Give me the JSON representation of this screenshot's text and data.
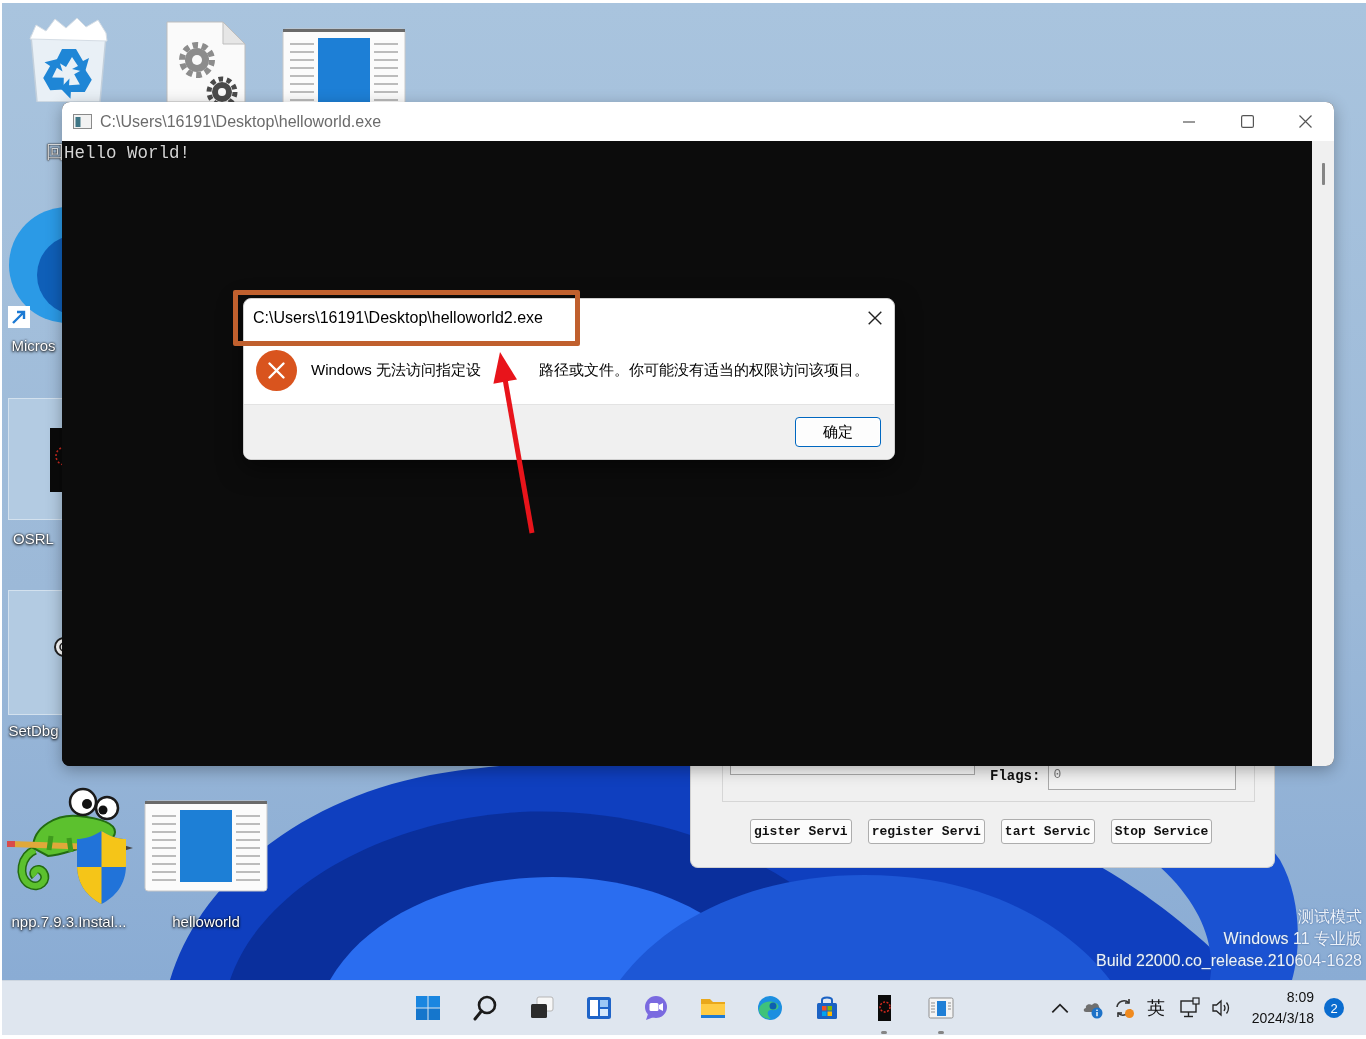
{
  "desktop_icons": [
    {
      "kind": "browser",
      "label": "Micros"
    },
    {
      "kind": "thumbnail",
      "label": "OSRL"
    },
    {
      "kind": "roundapp",
      "label": "SetDbg"
    },
    {
      "kind": "installer",
      "label": "npp.7.9.3.Instal..."
    },
    {
      "kind": "window",
      "label": "helloworld"
    }
  ],
  "console_window": {
    "title": "C:\\Users\\16191\\Desktop\\helloworld.exe",
    "output": [
      "回Hello World!"
    ]
  },
  "service_dialog": {
    "flags_label": "Flags:",
    "flags_value": "0",
    "buttons": [
      "gister Servi",
      "register Servi",
      "tart Servic",
      "Stop Service"
    ]
  },
  "error_dialog": {
    "title": "C:\\Users\\16191\\Desktop\\helloworld2.exe",
    "message_parts": [
      "Windows 无法访问指定设",
      "路径或文件。你可能没有适当的权限访问该项目。"
    ],
    "ok_button": "确定"
  },
  "taskbar": {
    "apps": [
      {
        "kind": "start",
        "running": false
      },
      {
        "kind": "search",
        "running": false
      },
      {
        "kind": "taskview",
        "running": false
      },
      {
        "kind": "widgets",
        "running": false
      },
      {
        "kind": "chat",
        "running": false
      },
      {
        "kind": "files",
        "running": false
      },
      {
        "kind": "browser",
        "running": false
      },
      {
        "kind": "store",
        "running": false
      },
      {
        "kind": "ring",
        "running": true
      },
      {
        "kind": "window",
        "running": true
      }
    ],
    "tray": {
      "input_method": "英",
      "time": "8:09",
      "date": "2024/3/18",
      "notifications": "2"
    }
  },
  "test_mode_notice": [
    "测试模式",
    "Windows 11 专业版",
    "Build 22000.co_release.210604-1628"
  ]
}
